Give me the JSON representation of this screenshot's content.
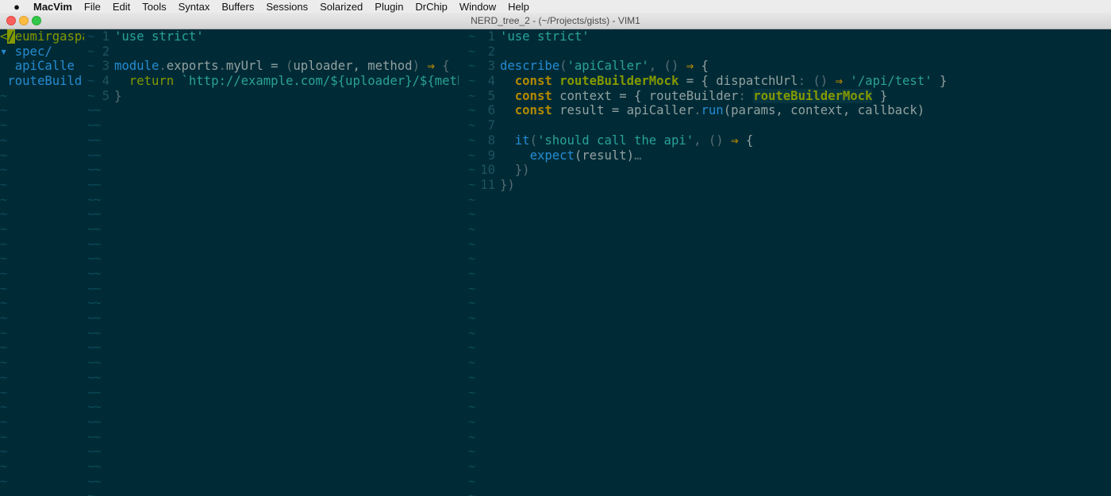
{
  "menubar": {
    "app_name": "MacVim",
    "items": [
      "File",
      "Edit",
      "Tools",
      "Syntax",
      "Buffers",
      "Sessions",
      "Solarized",
      "Plugin",
      "DrChip",
      "Window",
      "Help"
    ]
  },
  "window": {
    "title": "NERD_tree_2 - (~/Projects/gists) - VIM1"
  },
  "nerd_tree": {
    "root_marker": "<",
    "root_cursor": "/",
    "root_name": "eumirgaspa",
    "dir_marker": "▾",
    "dir_name": "spec/",
    "items": [
      "apiCalle",
      "routeBuild"
    ]
  },
  "editor": {
    "tilde": "~",
    "pane1": {
      "line_numbers": [
        "1",
        "2",
        "3",
        "4",
        "5"
      ],
      "code": {
        "l1": "'use strict'",
        "l3_module": "module",
        "l3_dot": ".",
        "l3_exports": "exports",
        "l3_dot2": ".",
        "l3_myUrl": "myUrl",
        "l3_eq": " = ",
        "l3_open": "(",
        "l3_params": "uploader, method",
        "l3_close": ")",
        "l3_arrow": " ⇒ ",
        "l3_brace": "{",
        "l4_return": "return",
        "l4_tpl": " `http://example.com/${uploader}/${method",
        "l5": "}"
      }
    },
    "pane2": {
      "line_numbers": [
        "1",
        "2",
        "3",
        "4",
        "5",
        "6",
        "7",
        "8",
        "9",
        "10",
        "11"
      ],
      "code": {
        "l1": "'use strict'",
        "l3_describe": "describe",
        "l3_open": "(",
        "l3_str": "'apiCaller'",
        "l3_comma": ", () ",
        "l3_arrow": "⇒",
        "l3_brace": " {",
        "l4_const": "const",
        "l4_name": "routeBuilderMock",
        "l4_eq": " = { ",
        "l4_key": "dispatchUrl",
        "l4_colon": ": () ",
        "l4_arrow": "⇒",
        "l4_str": " '/api/test'",
        "l4_close": " }",
        "l5_const": "const",
        "l5_rest": " context = { routeBuilder",
        "l5_colon": ": ",
        "l5_hl": "routeBuilderMock",
        "l5_close": " }",
        "l6_const": "const",
        "l6_a": " result = apiCaller",
        "l6_dot": ".",
        "l6_run": "run",
        "l6_args": "(params, context, callback)",
        "l8_it": "it",
        "l8_open": "(",
        "l8_str": "'should call the api'",
        "l8_comma": ", () ",
        "l8_arrow": "⇒",
        "l8_brace": " {",
        "l9_expect": "expect",
        "l9_args": "(result)",
        "l9_fold": "…",
        "l10": "})",
        "l11": "})"
      }
    }
  }
}
